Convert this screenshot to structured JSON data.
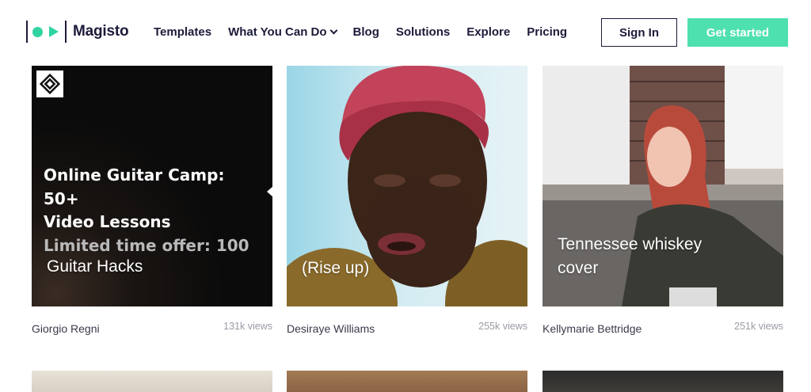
{
  "header": {
    "brand": "Magisto",
    "nav": [
      "Templates",
      "What You Can Do",
      "Blog",
      "Solutions",
      "Explore",
      "Pricing"
    ],
    "sign_in": "Sign In",
    "get_started": "Get started",
    "colors": {
      "accent": "#4fe0b0",
      "navy": "#1c1b3a"
    }
  },
  "promo": {
    "line1": "Online Guitar Camp:",
    "line2": "50+",
    "line3": "Video Lessons",
    "line4": "Limited time offer: 100"
  },
  "cards": [
    {
      "title": "Guitar Hacks",
      "author": "Giorgio Regni",
      "views": "131k views"
    },
    {
      "title": "(Rise up)",
      "author": "Desiraye Williams",
      "views": "255k views"
    },
    {
      "title_lines": [
        "Tennessee whiskey",
        "cover"
      ],
      "author": "Kellymarie Bettridge",
      "views": "251k views"
    }
  ]
}
